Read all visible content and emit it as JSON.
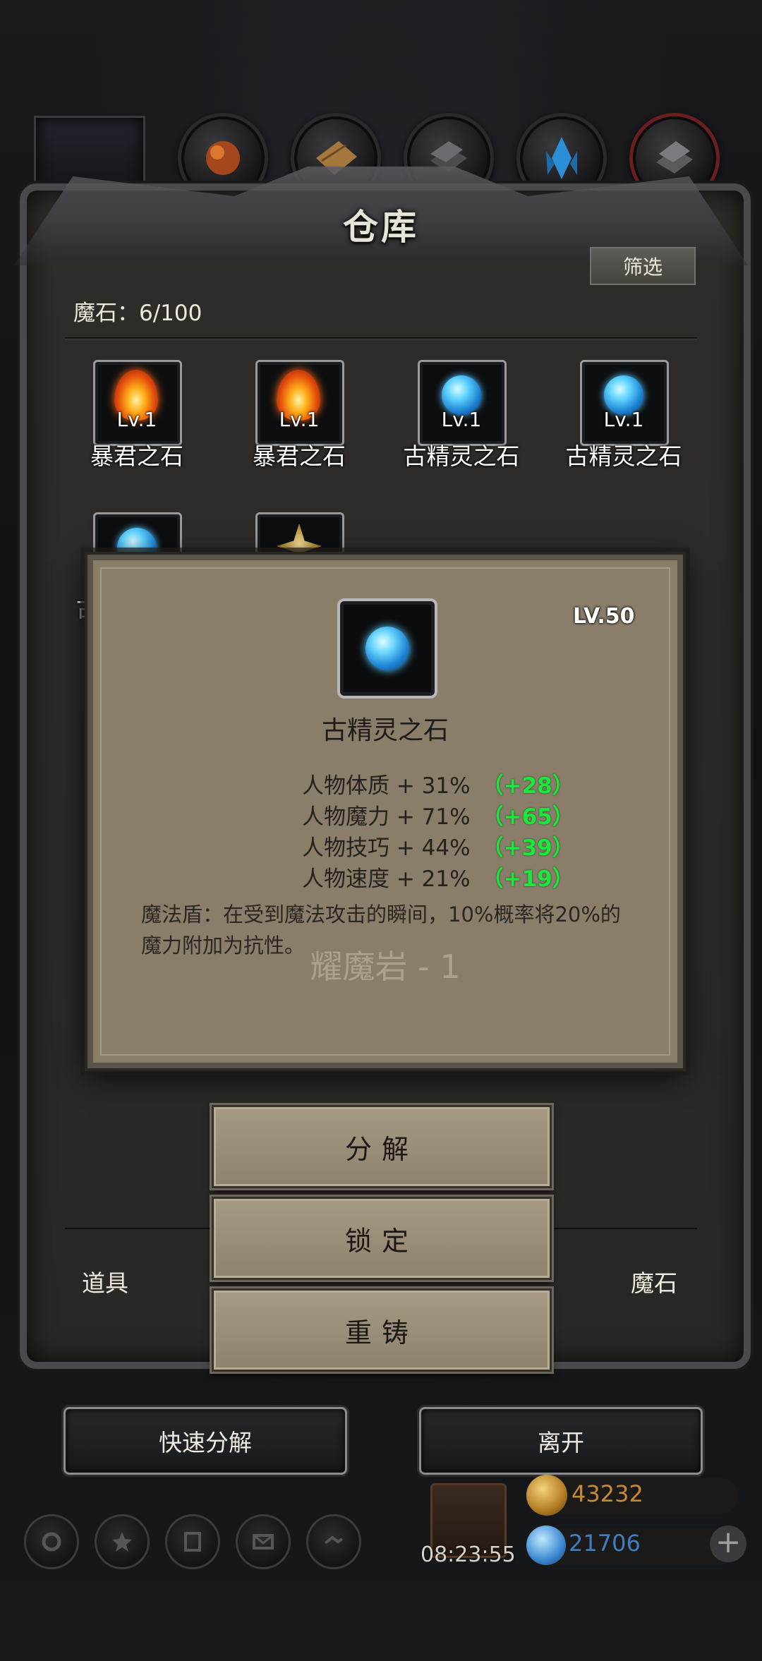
{
  "warehouse": {
    "title": "仓库",
    "filter_label": "筛选",
    "stone_count": "魔石：6/100"
  },
  "grid": {
    "items": [
      {
        "level": "Lv.1",
        "name": "暴君之石",
        "icon": "fire-stone-icon"
      },
      {
        "level": "Lv.1",
        "name": "暴君之石",
        "icon": "fire-stone-icon"
      },
      {
        "level": "Lv.1",
        "name": "古精灵之石",
        "icon": "blue-gem-icon"
      },
      {
        "level": "Lv.1",
        "name": "古精灵之石",
        "icon": "blue-gem-icon"
      },
      {
        "level": "",
        "name": "古",
        "icon": "blue-gem-icon"
      },
      {
        "level": "",
        "name": "",
        "icon": "gold-star-stone-icon"
      }
    ]
  },
  "popup": {
    "level": "LV.50",
    "name": "古精灵之石",
    "stats": [
      {
        "text": "人物体质 + 31%",
        "bonus": "（+28）"
      },
      {
        "text": "人物魔力 + 71%",
        "bonus": "（+65）"
      },
      {
        "text": "人物技巧 + 44%",
        "bonus": "（+39）"
      },
      {
        "text": "人物速度 + 21%",
        "bonus": "（+19）"
      }
    ],
    "description": "魔法盾：在受到魔法攻击的瞬间，10%概率将20%的魔力附加为抗性。",
    "watermark": "耀魔岩 - 1"
  },
  "actions": {
    "decompose": "分解",
    "lock": "锁定",
    "recast": "重铸"
  },
  "bottom_tabs": {
    "items": "道具",
    "stones": "魔石"
  },
  "footer": {
    "quick_decompose": "快速分解",
    "leave": "离开"
  },
  "hud": {
    "timer": "08:23:55",
    "gold": "43232",
    "gems": "21706",
    "plus": "+"
  },
  "colors": {
    "bonus_green": "#1ce83b",
    "popup_bg": "#8a7d6a",
    "gold_text": "#c48a35",
    "gem_text": "#3f7ec0"
  }
}
